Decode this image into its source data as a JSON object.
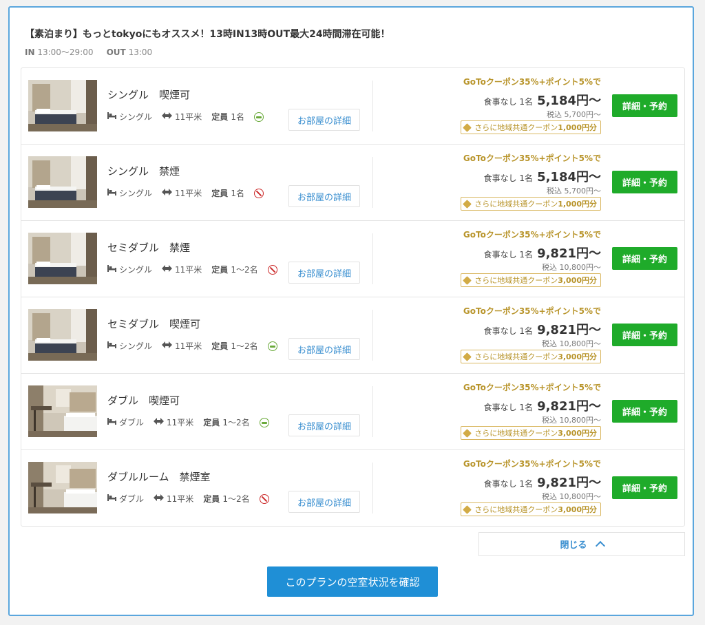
{
  "plan": {
    "title": "【素泊まり】もっとtokyoにもオススメ！13時IN13時OUT最大24時間滞在可能！",
    "in_label": "IN",
    "in_time": "13:00〜29:00",
    "out_label": "OUT",
    "out_time": "13:00"
  },
  "labels": {
    "detail_link": "お部屋の詳細",
    "book_button": "詳細・予約",
    "capacity": "定員",
    "size": "11平米",
    "goto_campaign": "GoToクーポン35%+ポイント5%で",
    "meal": "食事なし 1名",
    "coupon_prefix": "さらに地域共通クーポン",
    "close": "閉じる",
    "check_availability": "このプランの空室状況を確認"
  },
  "colors": {
    "accent_blue": "#3a8fd0",
    "book_green": "#1fab2a",
    "gold": "#b8942a",
    "smoking_ok": "#6aaa3a",
    "no_smoking": "#cc2b2b"
  },
  "rooms": [
    {
      "name": "シングル　喫煙可",
      "bed": "シングル",
      "capacity": "1名",
      "smoking": "smoking-icon",
      "price": "5,184円〜",
      "tax": "税込 5,700円〜",
      "coupon": "1,000円分",
      "photo": "single"
    },
    {
      "name": "シングル　禁煙",
      "bed": "シングル",
      "capacity": "1名",
      "smoking": "no-smoking-icon",
      "price": "5,184円〜",
      "tax": "税込 5,700円〜",
      "coupon": "1,000円分",
      "photo": "single"
    },
    {
      "name": "セミダブル　禁煙",
      "bed": "シングル",
      "capacity": "1〜2名",
      "smoking": "no-smoking-icon",
      "price": "9,821円〜",
      "tax": "税込 10,800円〜",
      "coupon": "3,000円分",
      "photo": "single"
    },
    {
      "name": "セミダブル　喫煙可",
      "bed": "シングル",
      "capacity": "1〜2名",
      "smoking": "smoking-icon",
      "price": "9,821円〜",
      "tax": "税込 10,800円〜",
      "coupon": "3,000円分",
      "photo": "single"
    },
    {
      "name": "ダブル　喫煙可",
      "bed": "ダブル",
      "capacity": "1〜2名",
      "smoking": "smoking-icon",
      "price": "9,821円〜",
      "tax": "税込 10,800円〜",
      "coupon": "3,000円分",
      "photo": "double"
    },
    {
      "name": "ダブルルーム　禁煙室",
      "bed": "ダブル",
      "capacity": "1〜2名",
      "smoking": "no-smoking-icon",
      "price": "9,821円〜",
      "tax": "税込 10,800円〜",
      "coupon": "3,000円分",
      "photo": "double"
    }
  ]
}
